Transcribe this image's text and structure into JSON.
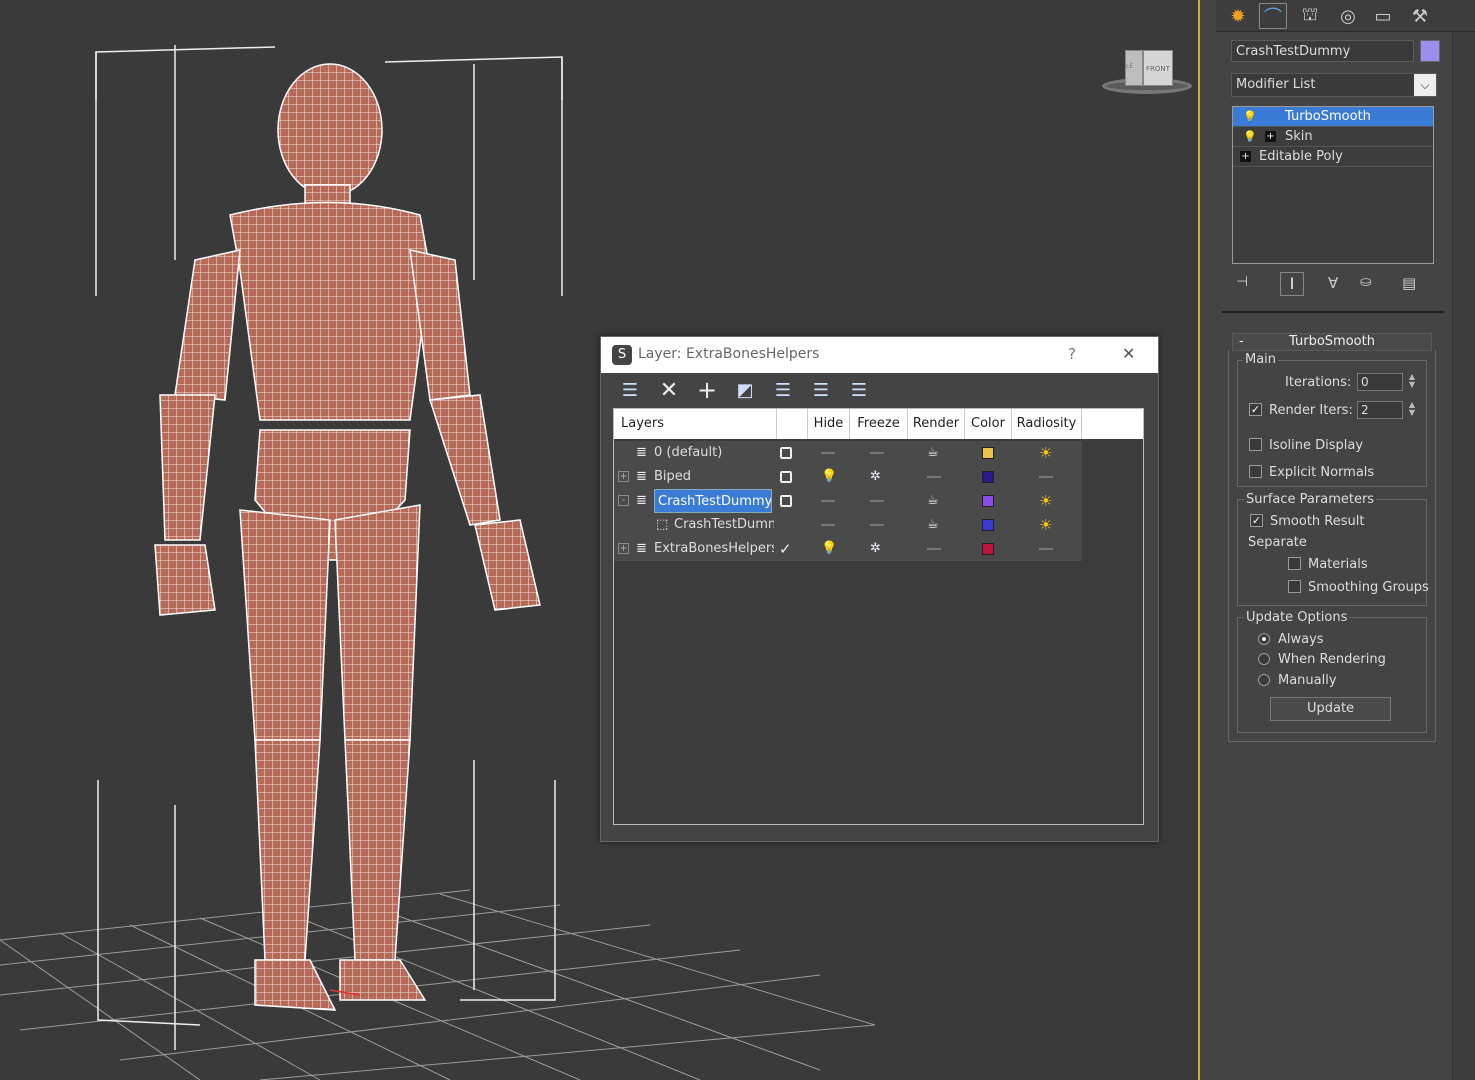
{
  "command_panel": {
    "tabs": [
      {
        "name": "create-icon"
      },
      {
        "name": "modify-icon"
      },
      {
        "name": "hierarchy-icon"
      },
      {
        "name": "motion-icon"
      },
      {
        "name": "display-icon"
      },
      {
        "name": "utilities-icon"
      }
    ],
    "object_name": "CrashTestDummy",
    "object_color": "#9a8ef0",
    "modifier_list": "Modifier List",
    "modifier_stack": [
      {
        "label": "TurboSmooth",
        "selected": true
      },
      {
        "label": "Skin",
        "selected": false
      },
      {
        "label": "Editable Poly",
        "selected": false
      }
    ],
    "turbosmooth": {
      "title": "TurboSmooth",
      "collapse": "-",
      "main_label": "Main",
      "iterations_label": "Iterations:",
      "iterations_value": "0",
      "render_iters_label": "Render Iters:",
      "render_iters_value": "2",
      "render_iters_checked": true,
      "isoline_label": "Isoline Display",
      "explicit_normals_label": "Explicit Normals",
      "surface_params_label": "Surface Parameters",
      "smooth_result_label": "Smooth Result",
      "separate_label": "Separate",
      "materials_label": "Materials",
      "smoothing_groups_label": "Smoothing Groups",
      "update_options_label": "Update Options",
      "always_label": "Always",
      "when_rendering_label": "When Rendering",
      "manually_label": "Manually",
      "update_button": "Update"
    }
  },
  "viewcube": {
    "face_label": "FRONT",
    "side_label": "LE"
  },
  "layer_dialog": {
    "title": "Layer: ExtraBonesHelpers",
    "help": "?",
    "close": "✕",
    "columns": [
      "Layers",
      "",
      "Hide",
      "Freeze",
      "Render",
      "Color",
      "Radiosity"
    ],
    "rows": [
      {
        "name": "0 (default)",
        "indent": 0,
        "expander": "",
        "current": "box",
        "hide": "dash",
        "freeze": "dash",
        "render": "teapot",
        "color": "#e8c44a",
        "radiosity": "sun",
        "selected": false
      },
      {
        "name": "Biped",
        "indent": 0,
        "expander": "+",
        "current": "box",
        "hide": "bulb",
        "freeze": "snow",
        "render": "dash",
        "color": "#2a1a8a",
        "radiosity": "dash",
        "selected": false
      },
      {
        "name": "CrashTestDummy",
        "indent": 0,
        "expander": "-",
        "current": "box",
        "hide": "dash",
        "freeze": "dash",
        "render": "teapot",
        "color": "#8a4ae8",
        "radiosity": "sun",
        "selected": true
      },
      {
        "name": "CrashTestDumm",
        "indent": 1,
        "expander": "",
        "current": "",
        "hide": "dash",
        "freeze": "dash",
        "render": "teapot",
        "color": "#3a3ad8",
        "radiosity": "sun",
        "selected": false
      },
      {
        "name": "ExtraBonesHelpers",
        "indent": 0,
        "expander": "+",
        "current": "check",
        "hide": "bulb",
        "freeze": "snow",
        "render": "dash",
        "color": "#c0143c",
        "radiosity": "dash",
        "selected": false
      }
    ]
  }
}
